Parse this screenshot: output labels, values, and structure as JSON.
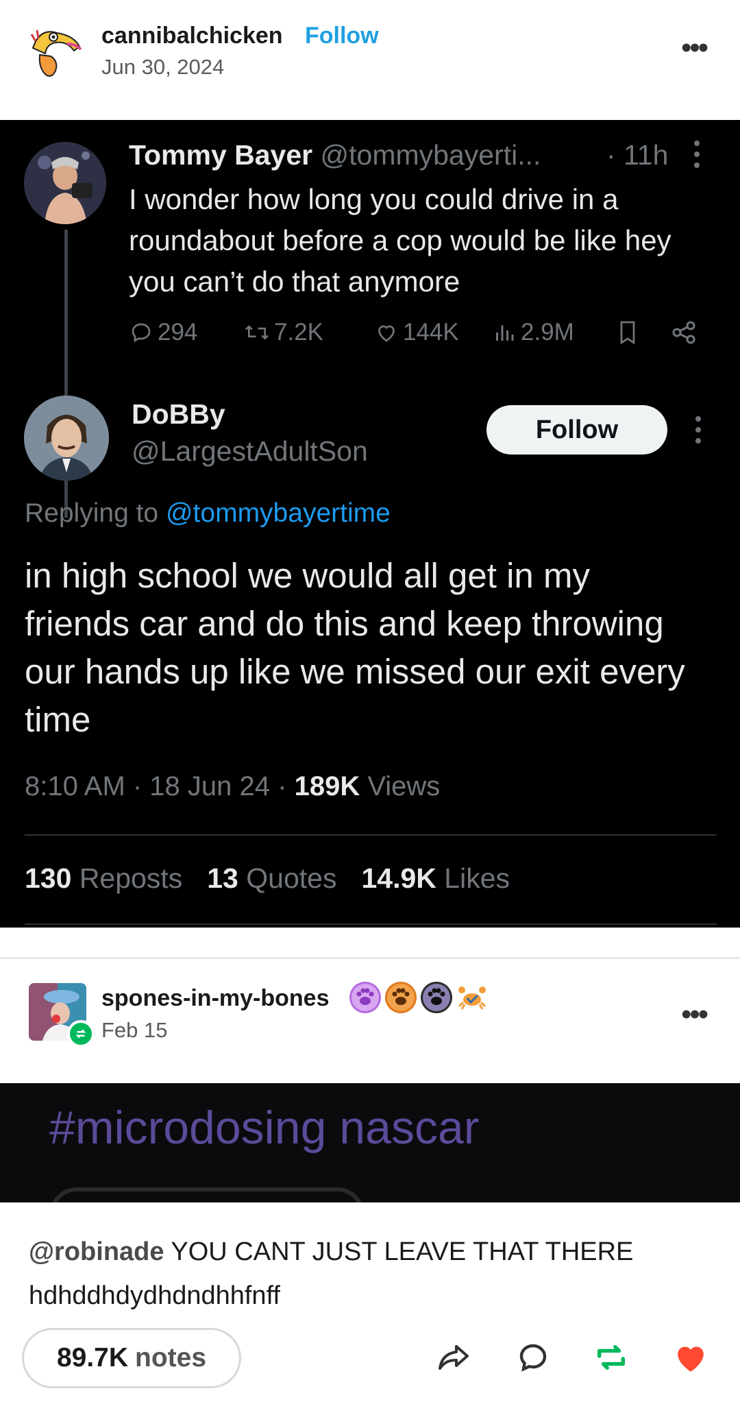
{
  "post": {
    "author": "cannibalchicken",
    "follow_label": "Follow",
    "date": "Jun 30, 2024",
    "more_label": "•••"
  },
  "tweet_image": {
    "original": {
      "name": "Tommy Bayer",
      "handle": "@tommybayerti...",
      "time": "· 11h",
      "text": "I wonder how long you could drive in a roundabout before a cop would be like hey you can’t do that anymore",
      "replies": "294",
      "reposts": "7.2K",
      "likes": "144K",
      "views": "2.9M"
    },
    "reply": {
      "name": "DoBBy",
      "handle": "@LargestAdultSon",
      "follow_label": "Follow",
      "replying_prefix": "Replying to",
      "replying_to": "@tommybayertime",
      "text": "in high school we would all get in my friends car and do this and keep throwing our hands up like we missed our exit every time",
      "timestamp": "8:10 AM · 18 Jun 24 ·",
      "views_count": "189K",
      "views_label": "Views",
      "reposts_count": "130",
      "reposts_label": "Reposts",
      "quotes_count": "13",
      "quotes_label": "Quotes",
      "likes_count": "14.9K",
      "likes_label": "Likes"
    }
  },
  "reblog": {
    "author": "spones-in-my-bones",
    "date": "Feb 15",
    "more_label": "•••",
    "badge_colors": [
      "#b46be0",
      "#e07a1f",
      "#2b2b2b",
      "#f29d38"
    ],
    "image_text": "#microdosing nascar",
    "comment_mention": "@robinade",
    "comment_text": " YOU CANT JUST LEAVE THAT THERE hdhddhdydhdndhhfnff"
  },
  "footer": {
    "notes_count": "89.7K",
    "notes_label": "notes",
    "icons": [
      "share-icon",
      "reply-icon",
      "reblog-icon",
      "like-icon"
    ],
    "reblog_color": "#00b85c",
    "like_color": "#ff4930"
  }
}
